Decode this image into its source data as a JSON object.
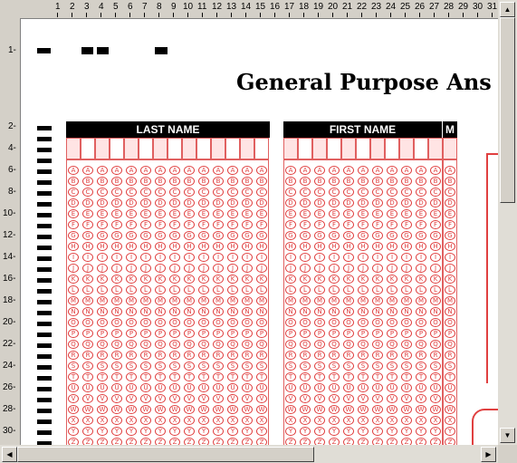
{
  "document": {
    "title": "General Purpose Ans",
    "sections": {
      "last_name": "LAST NAME",
      "first_name": "FIRST NAME",
      "middle_initial": "M"
    },
    "bubble_letters": [
      "A",
      "B",
      "C",
      "D",
      "E",
      "F",
      "G",
      "H",
      "I",
      "J",
      "K",
      "L",
      "M",
      "N",
      "O",
      "P",
      "Q",
      "R",
      "S",
      "T",
      "U",
      "V",
      "W",
      "X",
      "Y",
      "Z"
    ]
  },
  "ruler": {
    "top_numbers": [
      "1",
      "2",
      "3",
      "4",
      "5",
      "6",
      "7",
      "8",
      "9",
      "10",
      "11",
      "12",
      "13",
      "14",
      "15",
      "16",
      "17",
      "18",
      "19",
      "20",
      "21",
      "22",
      "23",
      "24",
      "25",
      "26",
      "27",
      "28",
      "29",
      "30",
      "31"
    ],
    "left_numbers": [
      "1",
      "2",
      "4",
      "6",
      "8",
      "10",
      "12",
      "14",
      "16",
      "18",
      "20",
      "22",
      "24",
      "26",
      "28",
      "30"
    ]
  },
  "scrollbars": {
    "up_arrow": "▲",
    "down_arrow": "▼",
    "left_arrow": "◀",
    "right_arrow": "▶"
  }
}
